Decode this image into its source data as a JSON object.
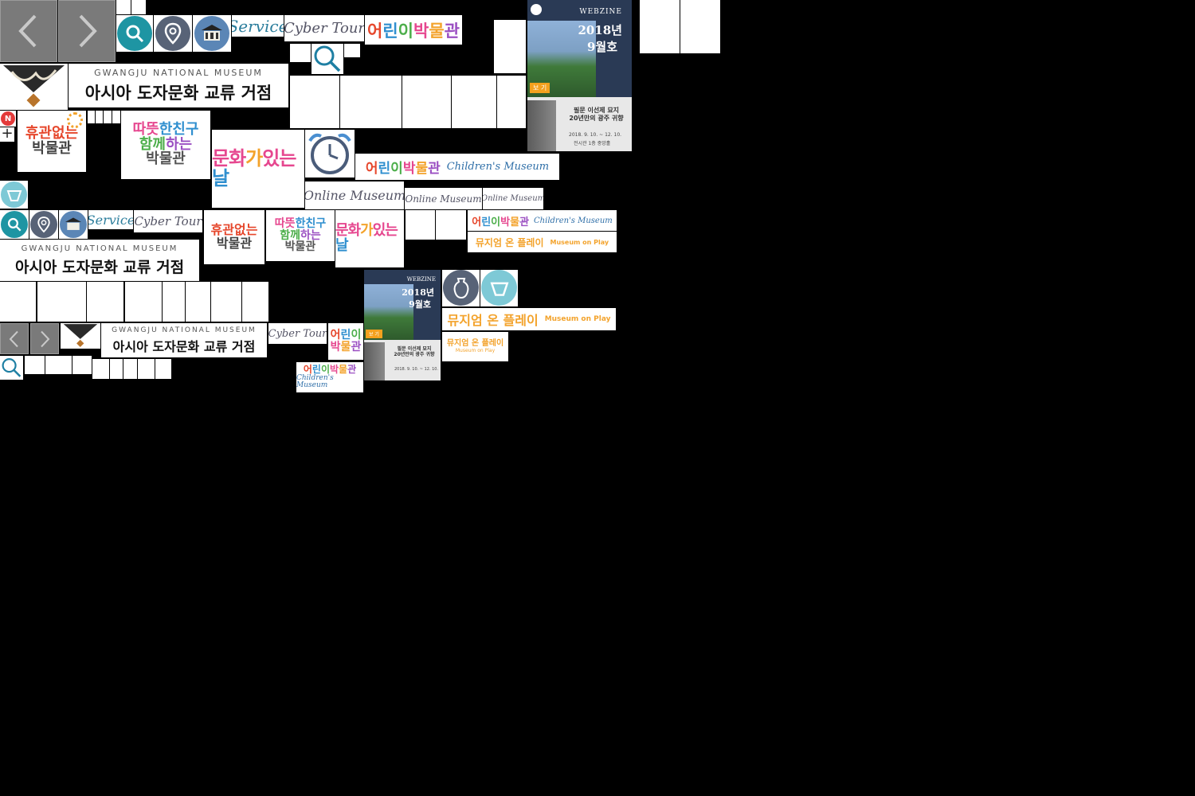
{
  "nav": {
    "prev_icon": "chevron-left-icon",
    "next_icon": "chevron-right-icon"
  },
  "icons": {
    "search": "search-icon",
    "location": "location-pin-icon",
    "building": "museum-building-icon",
    "alarm": "alarm-clock-icon",
    "new_badge": "N",
    "plus": "+"
  },
  "labels": {
    "service": "Service",
    "cyber_tour": "Cyber Tour",
    "online_museum": "Online Museum",
    "childrens_museum_en": "Children's Museum",
    "childrens_museum_ko": "어린이박물관",
    "gnm_en": "GWANGJU NATIONAL MUSEUM",
    "gnm_ko": "아시아 도자문화 교류 거점",
    "no_holiday": [
      "휴관없는",
      "박물관"
    ],
    "with_friend": [
      "따뜻한친구",
      "함께하는",
      "박물관"
    ],
    "culture_day": [
      "문화가 있는 날"
    ],
    "museum_on_play_ko": "뮤지엄 온 플레이",
    "museum_on_play_en": "Museum on Play"
  },
  "webzine": {
    "tag": "WEBZINE",
    "issue_year": "2018년",
    "issue_month": "9월호",
    "button": "보 기",
    "article": [
      "필문 이선제 묘지",
      "20년만의 광주 귀향"
    ],
    "date": "2018. 9. 10. ~ 12. 10.",
    "venue": "전시관 1층 중앙홀"
  },
  "colors": {
    "teal": "#1e95a3",
    "slate": "#586377",
    "navy": "#2a3a55",
    "orange": "#f4a11e"
  }
}
